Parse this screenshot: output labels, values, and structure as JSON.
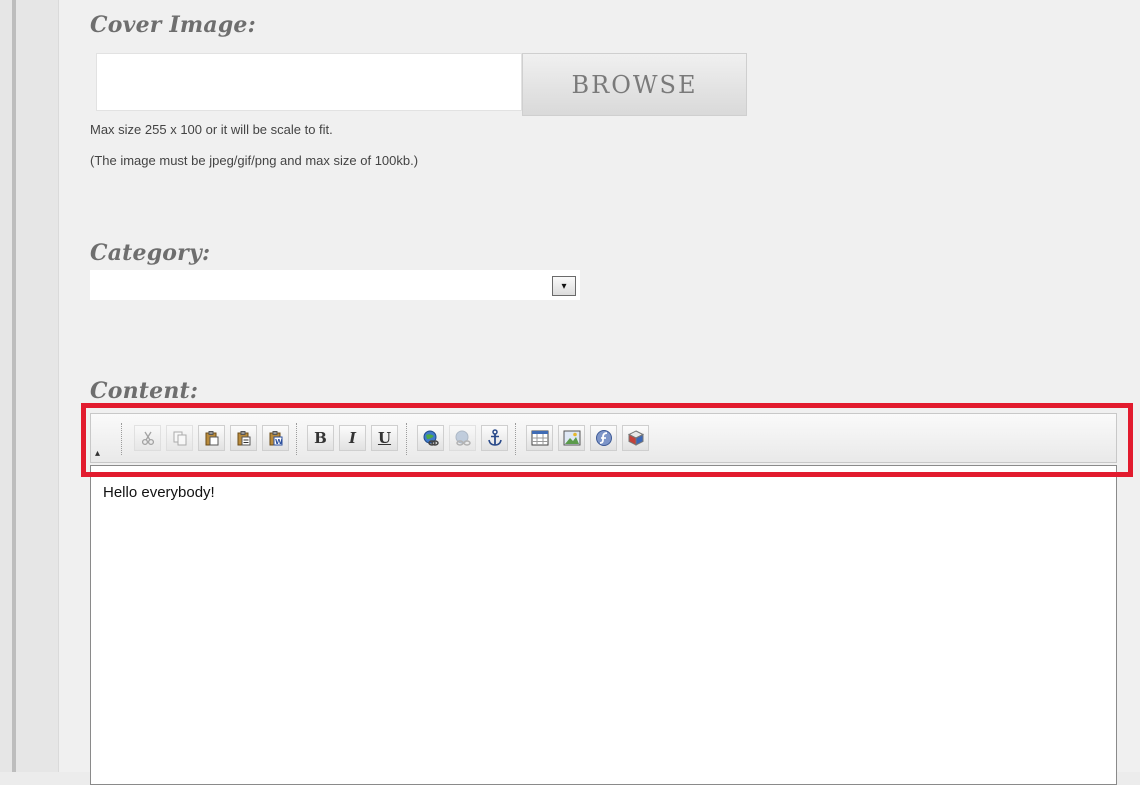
{
  "cover_image": {
    "label": "Cover Image:",
    "file_value": "",
    "browse_label": "BROWSE",
    "help_lines": [
      "Max size 255 x 100 or it will be scale to fit.",
      "(The image must be jpeg/gif/png and max size of 100kb.)"
    ]
  },
  "category": {
    "label": "Category:",
    "selected": "",
    "arrow": "▾"
  },
  "content": {
    "label": "Content:",
    "editor_text": "Hello everybody!",
    "toolbar": {
      "collapse_glyph": "▴",
      "bold": "B",
      "italic": "I",
      "underline": "U",
      "icons": [
        "cut-icon",
        "copy-icon",
        "paste-icon",
        "paste-text-icon",
        "paste-word-icon",
        "bold-icon",
        "italic-icon",
        "underline-icon",
        "link-icon",
        "unlink-icon",
        "anchor-icon",
        "table-icon",
        "image-icon",
        "flash-icon",
        "plugin-icon"
      ]
    }
  },
  "colors": {
    "highlight": "#e21b2e",
    "background": "#f0f0f0"
  }
}
